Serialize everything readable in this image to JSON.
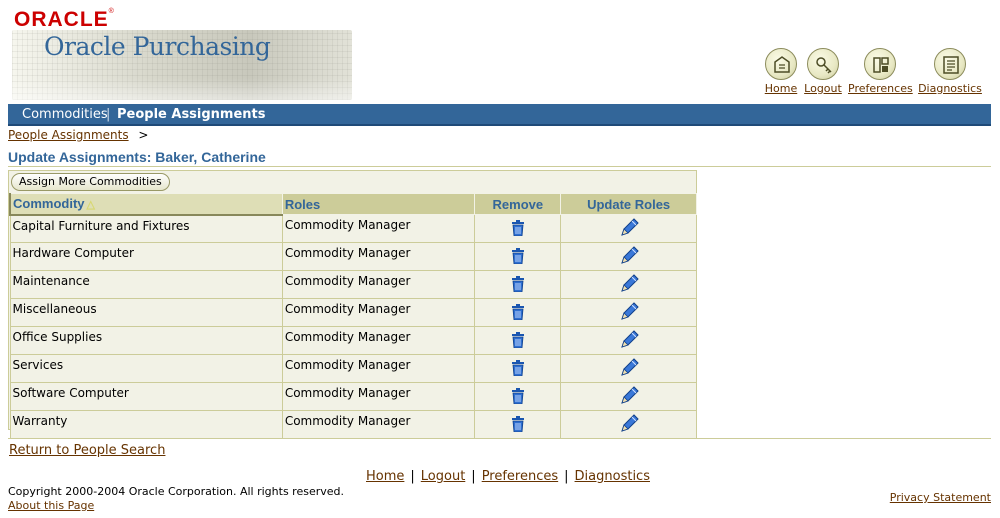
{
  "branding": {
    "logo_text": "ORACLE",
    "app_name": "Oracle Purchasing"
  },
  "global_buttons": [
    {
      "label": "Home",
      "icon": "home-icon"
    },
    {
      "label": "Logout",
      "icon": "logout-icon"
    },
    {
      "label": "Preferences",
      "icon": "preferences-icon"
    },
    {
      "label": "Diagnostics",
      "icon": "diagnostics-icon"
    }
  ],
  "tabs": {
    "commodities": "Commodities",
    "separator": "|",
    "people_assignments": "People Assignments"
  },
  "breadcrumb": {
    "item": "People Assignments",
    "separator": ">"
  },
  "page_title": "Update Assignments: Baker, Catherine",
  "assign_button": "Assign More Commodities",
  "table": {
    "headers": [
      "Commodity",
      "Roles",
      "Remove",
      "Update Roles"
    ],
    "sort_indicator": "△",
    "rows": [
      {
        "commodity": "Capital Furniture and Fixtures",
        "role": "Commodity Manager"
      },
      {
        "commodity": "Hardware Computer",
        "role": "Commodity Manager"
      },
      {
        "commodity": "Maintenance",
        "role": "Commodity Manager"
      },
      {
        "commodity": "Miscellaneous",
        "role": "Commodity Manager"
      },
      {
        "commodity": "Office Supplies",
        "role": "Commodity Manager"
      },
      {
        "commodity": "Services",
        "role": "Commodity Manager"
      },
      {
        "commodity": "Software Computer",
        "role": "Commodity Manager"
      },
      {
        "commodity": "Warranty",
        "role": "Commodity Manager"
      }
    ]
  },
  "return_link": "Return to People Search",
  "footer": {
    "links": [
      "Home",
      "Logout",
      "Preferences",
      "Diagnostics"
    ],
    "separator": "|",
    "copyright": "Copyright 2000-2004 Oracle Corporation. All rights reserved.",
    "about": "About this Page",
    "privacy": "Privacy Statement"
  },
  "colors": {
    "accent": "#336699",
    "link": "#663300",
    "table_header": "#cccc99",
    "table_bg": "#f2f2e6",
    "logo_red": "#cc0000"
  }
}
